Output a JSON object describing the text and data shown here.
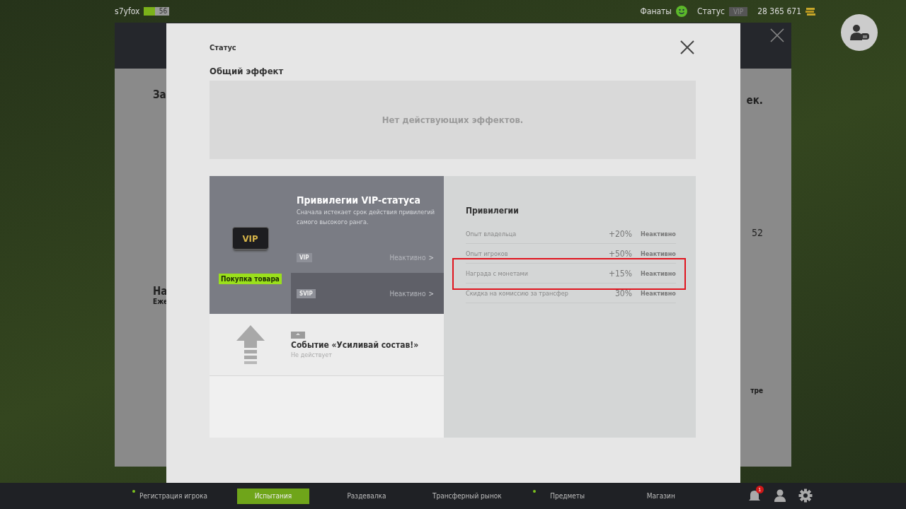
{
  "top_bar": {
    "username": "s7yfox",
    "level_badge": {
      "text": "56",
      "level": 0.45
    },
    "fans_label": "Фанаты",
    "status_label": "Статус",
    "status_badge": "VIP",
    "coins": "28 365 671"
  },
  "background_panel": {
    "left_fragments": [
      {
        "text": "За",
        "kind": "heading"
      },
      {
        "text": "На",
        "kind": "heading"
      },
      {
        "text": "Еже",
        "kind": "sub"
      }
    ],
    "right_fragments": [
      {
        "text": "ек.",
        "kind": "heading"
      },
      {
        "text": "52",
        "kind": "number"
      },
      {
        "text": "тре",
        "kind": "sub"
      }
    ]
  },
  "modal": {
    "title": "Статус",
    "section_title": "Общий эффект",
    "effects_empty": "Нет действующих эффектов.",
    "vip_card": {
      "title": "Привилегии VIP-статуса",
      "description": "Сначала истекает срок действия привилегий самого высокого ранга.",
      "buy_label": "Покупка товара",
      "icon_label": "VIP",
      "tiers": [
        {
          "badge": "VIP",
          "status": "Неактивно",
          "arrow": ">",
          "selected": true
        },
        {
          "badge": "SVIP",
          "status": "Неактивно",
          "arrow": ">",
          "selected": false
        }
      ]
    },
    "event_card": {
      "title": "Событие «Усиливай состав!»",
      "status": "Не действует"
    },
    "privileges": {
      "title": "Привилегии",
      "rows": [
        {
          "name": "Опыт владельца",
          "value": "+20%",
          "status": "Неактивно",
          "highlighted": false
        },
        {
          "name": "Опыт игроков",
          "value": "+50%",
          "status": "Неактивно",
          "highlighted": false
        },
        {
          "name": "Награда с монетами",
          "value": "+15%",
          "status": "Неактивно",
          "highlighted": true
        },
        {
          "name": "Скидка на комиссию за трансфер",
          "value": "30%",
          "status": "Неактивно",
          "highlighted": false
        }
      ]
    }
  },
  "bottom_nav": {
    "items": [
      {
        "label": "Регистрация игрока",
        "dot": true,
        "selected": false
      },
      {
        "label": "Испытания",
        "dot": false,
        "selected": true
      },
      {
        "label": "Раздевалка",
        "dot": false,
        "selected": false
      },
      {
        "label": "Трансферный рынок",
        "dot": false,
        "selected": false
      },
      {
        "label": "Предметы",
        "dot": true,
        "selected": false
      },
      {
        "label": "Магазин",
        "dot": false,
        "selected": false
      }
    ],
    "notification_count": "1"
  }
}
